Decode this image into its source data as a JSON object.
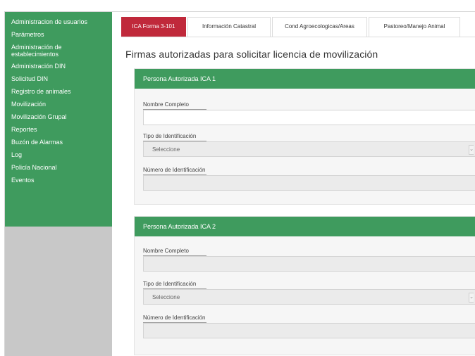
{
  "sidebar": {
    "items": [
      {
        "label": "Administracion de usuarios"
      },
      {
        "label": "Parámetros"
      },
      {
        "label": "Administración de establecimientos"
      },
      {
        "label": "Administración DIN"
      },
      {
        "label": "Solicitud DIN"
      },
      {
        "label": "Registro de animales"
      },
      {
        "label": "Movilización"
      },
      {
        "label": "Movilización Grupal"
      },
      {
        "label": "Reportes"
      },
      {
        "label": "Buzón de Alarmas"
      },
      {
        "label": "Log"
      },
      {
        "label": "Policía Nacional"
      },
      {
        "label": "Eventos"
      }
    ]
  },
  "tabs": [
    {
      "label": "ICA Forma 3-101",
      "active": true
    },
    {
      "label": "Información Catastral",
      "active": false
    },
    {
      "label": "Cond Agroecologicas/Areas",
      "active": false
    },
    {
      "label": "Pastoreo/Manejo Animal",
      "active": false
    }
  ],
  "main": {
    "title": "Firmas autorizadas para solicitar licencia de movilización",
    "cards": [
      {
        "header": "Persona Autorizada ICA 1",
        "name_label": "Nombre Completo",
        "name_value": "",
        "id_type_label": "Tipo de Identificación",
        "id_type_value": "Seleccione",
        "id_number_label": "Número de Identificación",
        "id_number_value": ""
      },
      {
        "header": "Persona Autorizada ICA 2",
        "name_label": "Nombre Completo",
        "name_value": "",
        "id_type_label": "Tipo de Identificación",
        "id_type_value": "Seleccione",
        "id_number_label": "Número de Identificación",
        "id_number_value": ""
      }
    ]
  },
  "colors": {
    "sidebar_green": "#3f9b5e",
    "sidebar_gray": "#c8c8c8",
    "active_tab_red": "#c0293b",
    "card_header_green": "#3f9b5e"
  }
}
